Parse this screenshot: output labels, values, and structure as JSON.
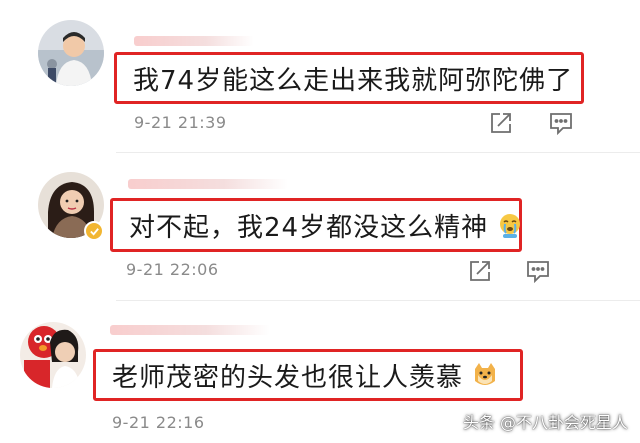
{
  "comments": [
    {
      "username": "",
      "text": "我74岁能这么走出来我就阿弥陀佛了",
      "emoji": "",
      "time": "9-21 21:39",
      "verified": false
    },
    {
      "username": "",
      "text": "对不起，我24岁都没这么精神",
      "emoji": "crying-emoji",
      "time": "9-21 22:06",
      "verified": true
    },
    {
      "username": "",
      "text": "老师茂密的头发也很让人羡慕",
      "emoji": "doge-emoji",
      "time": "9-21 22:16",
      "verified": false
    }
  ],
  "actions": {
    "share_icon": "share-icon",
    "comment_icon": "comment-icon"
  },
  "watermark": "头条 @不八卦会死星人",
  "colors": {
    "highlight_border": "#e02424",
    "time_text": "#8a8a8a",
    "badge": "#f2b632"
  }
}
